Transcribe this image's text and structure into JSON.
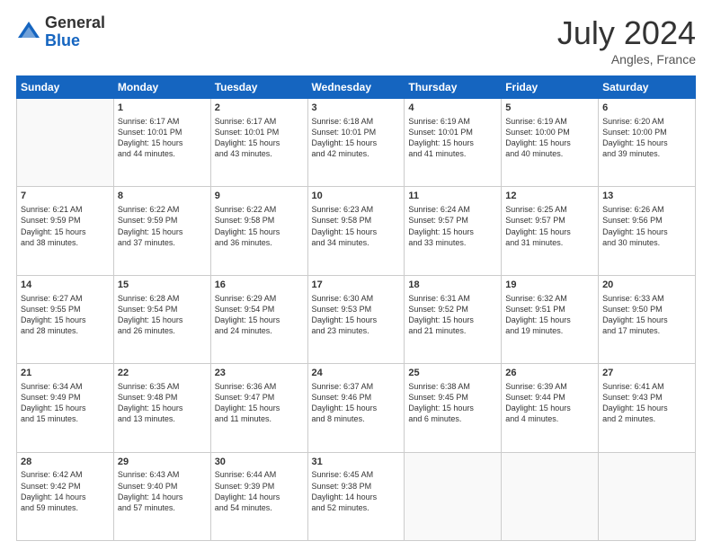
{
  "header": {
    "logo_general": "General",
    "logo_blue": "Blue",
    "month": "July 2024",
    "location": "Angles, France"
  },
  "days_of_week": [
    "Sunday",
    "Monday",
    "Tuesday",
    "Wednesday",
    "Thursday",
    "Friday",
    "Saturday"
  ],
  "weeks": [
    [
      {
        "day": "",
        "info": ""
      },
      {
        "day": "1",
        "info": "Sunrise: 6:17 AM\nSunset: 10:01 PM\nDaylight: 15 hours\nand 44 minutes."
      },
      {
        "day": "2",
        "info": "Sunrise: 6:17 AM\nSunset: 10:01 PM\nDaylight: 15 hours\nand 43 minutes."
      },
      {
        "day": "3",
        "info": "Sunrise: 6:18 AM\nSunset: 10:01 PM\nDaylight: 15 hours\nand 42 minutes."
      },
      {
        "day": "4",
        "info": "Sunrise: 6:19 AM\nSunset: 10:01 PM\nDaylight: 15 hours\nand 41 minutes."
      },
      {
        "day": "5",
        "info": "Sunrise: 6:19 AM\nSunset: 10:00 PM\nDaylight: 15 hours\nand 40 minutes."
      },
      {
        "day": "6",
        "info": "Sunrise: 6:20 AM\nSunset: 10:00 PM\nDaylight: 15 hours\nand 39 minutes."
      }
    ],
    [
      {
        "day": "7",
        "info": "Sunrise: 6:21 AM\nSunset: 9:59 PM\nDaylight: 15 hours\nand 38 minutes."
      },
      {
        "day": "8",
        "info": "Sunrise: 6:22 AM\nSunset: 9:59 PM\nDaylight: 15 hours\nand 37 minutes."
      },
      {
        "day": "9",
        "info": "Sunrise: 6:22 AM\nSunset: 9:58 PM\nDaylight: 15 hours\nand 36 minutes."
      },
      {
        "day": "10",
        "info": "Sunrise: 6:23 AM\nSunset: 9:58 PM\nDaylight: 15 hours\nand 34 minutes."
      },
      {
        "day": "11",
        "info": "Sunrise: 6:24 AM\nSunset: 9:57 PM\nDaylight: 15 hours\nand 33 minutes."
      },
      {
        "day": "12",
        "info": "Sunrise: 6:25 AM\nSunset: 9:57 PM\nDaylight: 15 hours\nand 31 minutes."
      },
      {
        "day": "13",
        "info": "Sunrise: 6:26 AM\nSunset: 9:56 PM\nDaylight: 15 hours\nand 30 minutes."
      }
    ],
    [
      {
        "day": "14",
        "info": "Sunrise: 6:27 AM\nSunset: 9:55 PM\nDaylight: 15 hours\nand 28 minutes."
      },
      {
        "day": "15",
        "info": "Sunrise: 6:28 AM\nSunset: 9:54 PM\nDaylight: 15 hours\nand 26 minutes."
      },
      {
        "day": "16",
        "info": "Sunrise: 6:29 AM\nSunset: 9:54 PM\nDaylight: 15 hours\nand 24 minutes."
      },
      {
        "day": "17",
        "info": "Sunrise: 6:30 AM\nSunset: 9:53 PM\nDaylight: 15 hours\nand 23 minutes."
      },
      {
        "day": "18",
        "info": "Sunrise: 6:31 AM\nSunset: 9:52 PM\nDaylight: 15 hours\nand 21 minutes."
      },
      {
        "day": "19",
        "info": "Sunrise: 6:32 AM\nSunset: 9:51 PM\nDaylight: 15 hours\nand 19 minutes."
      },
      {
        "day": "20",
        "info": "Sunrise: 6:33 AM\nSunset: 9:50 PM\nDaylight: 15 hours\nand 17 minutes."
      }
    ],
    [
      {
        "day": "21",
        "info": "Sunrise: 6:34 AM\nSunset: 9:49 PM\nDaylight: 15 hours\nand 15 minutes."
      },
      {
        "day": "22",
        "info": "Sunrise: 6:35 AM\nSunset: 9:48 PM\nDaylight: 15 hours\nand 13 minutes."
      },
      {
        "day": "23",
        "info": "Sunrise: 6:36 AM\nSunset: 9:47 PM\nDaylight: 15 hours\nand 11 minutes."
      },
      {
        "day": "24",
        "info": "Sunrise: 6:37 AM\nSunset: 9:46 PM\nDaylight: 15 hours\nand 8 minutes."
      },
      {
        "day": "25",
        "info": "Sunrise: 6:38 AM\nSunset: 9:45 PM\nDaylight: 15 hours\nand 6 minutes."
      },
      {
        "day": "26",
        "info": "Sunrise: 6:39 AM\nSunset: 9:44 PM\nDaylight: 15 hours\nand 4 minutes."
      },
      {
        "day": "27",
        "info": "Sunrise: 6:41 AM\nSunset: 9:43 PM\nDaylight: 15 hours\nand 2 minutes."
      }
    ],
    [
      {
        "day": "28",
        "info": "Sunrise: 6:42 AM\nSunset: 9:42 PM\nDaylight: 14 hours\nand 59 minutes."
      },
      {
        "day": "29",
        "info": "Sunrise: 6:43 AM\nSunset: 9:40 PM\nDaylight: 14 hours\nand 57 minutes."
      },
      {
        "day": "30",
        "info": "Sunrise: 6:44 AM\nSunset: 9:39 PM\nDaylight: 14 hours\nand 54 minutes."
      },
      {
        "day": "31",
        "info": "Sunrise: 6:45 AM\nSunset: 9:38 PM\nDaylight: 14 hours\nand 52 minutes."
      },
      {
        "day": "",
        "info": ""
      },
      {
        "day": "",
        "info": ""
      },
      {
        "day": "",
        "info": ""
      }
    ]
  ]
}
